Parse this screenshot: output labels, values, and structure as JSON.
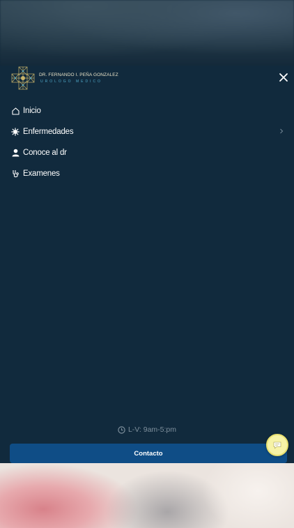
{
  "logo": {
    "name": "DR. FERNANDO I. PEÑA GONZALEZ",
    "subtitle": "UROLOGO MEDICO"
  },
  "menu": {
    "items": [
      {
        "label": "Inicio",
        "icon": "home-icon"
      },
      {
        "label": "Enfermedades",
        "icon": "virus-icon",
        "has_submenu": true
      },
      {
        "label": "Conoce al dr",
        "icon": "user-icon"
      },
      {
        "label": "Examenes",
        "icon": "stethoscope-icon"
      }
    ]
  },
  "footer": {
    "hours": "L-V: 9am-5:pm",
    "contact_label": "Contacto"
  },
  "colors": {
    "drawer_bg": "#112a3d",
    "contact_button": "#0f4d86",
    "chat_button": "#f7f3a6"
  }
}
